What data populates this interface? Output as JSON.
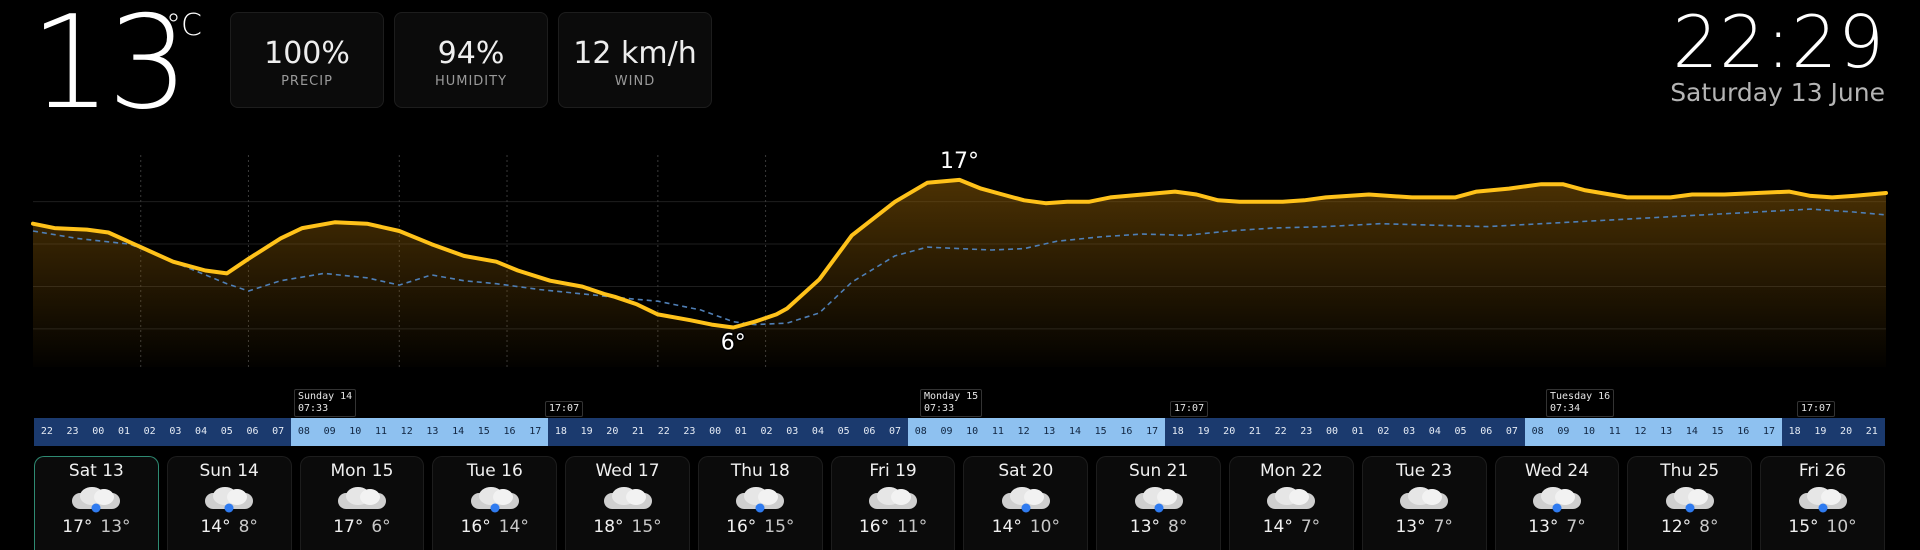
{
  "current": {
    "temperature": "13",
    "unit": "°C"
  },
  "stats": [
    {
      "value": "100%",
      "label": "PRECIP"
    },
    {
      "value": "94%",
      "label": "HUMIDITY"
    },
    {
      "value": "12 km/h",
      "label": "WIND"
    }
  ],
  "clock": {
    "time": "22:29",
    "date": "Saturday 13 June"
  },
  "chart": {
    "max_label": "17°",
    "min_label": "6°",
    "colors": {
      "temp": "#ffc21a",
      "feels": "#4f7fb6",
      "fill": "#8a5a06"
    }
  },
  "chart_data": {
    "type": "line",
    "x_unit": "hours from 22:00 Sat 13",
    "series": [
      {
        "name": "temperature",
        "x": [
          0,
          2,
          5,
          7,
          10,
          13,
          16,
          18,
          20,
          23,
          25,
          28,
          31,
          34,
          37,
          40,
          43,
          45,
          48,
          51,
          53,
          54,
          56,
          58,
          61,
          63,
          65,
          67,
          69,
          70,
          73,
          76,
          80,
          83,
          86,
          88,
          90,
          92,
          94,
          96,
          98,
          100,
          103,
          106,
          108,
          110,
          112,
          114,
          116,
          118,
          120,
          124,
          128,
          132,
          134,
          137,
          140,
          142,
          144,
          148,
          150,
          152,
          154,
          157,
          160,
          163,
          165,
          167,
          169,
          172
        ],
        "y": [
          13.8,
          13.5,
          13.4,
          13.2,
          12.2,
          11.2,
          10.6,
          10.4,
          11.4,
          12.8,
          13.5,
          13.9,
          13.8,
          13.3,
          12.4,
          11.6,
          11.2,
          10.6,
          9.9,
          9.5,
          9.0,
          8.8,
          8.3,
          7.6,
          7.2,
          6.9,
          6.7,
          7.1,
          7.6,
          8.0,
          10.0,
          13.0,
          15.3,
          16.6,
          16.8,
          16.2,
          15.8,
          15.4,
          15.2,
          15.3,
          15.3,
          15.6,
          15.8,
          16.0,
          15.8,
          15.4,
          15.3,
          15.3,
          15.3,
          15.4,
          15.6,
          15.8,
          15.6,
          15.6,
          16.0,
          16.2,
          16.5,
          16.5,
          16.1,
          15.6,
          15.6,
          15.6,
          15.8,
          15.8,
          15.9,
          16.0,
          15.7,
          15.6,
          15.7,
          15.9
        ]
      },
      {
        "name": "feels like",
        "x": [
          0,
          4,
          9,
          14,
          18,
          20,
          23,
          27,
          31,
          34,
          37,
          40,
          43,
          47,
          51,
          55,
          58,
          62,
          65,
          67,
          70,
          73,
          76,
          80,
          83,
          86,
          89,
          92,
          95,
          99,
          103,
          107,
          111,
          115,
          120,
          125,
          130,
          135,
          140,
          145,
          150,
          155,
          160,
          165,
          169,
          172
        ],
        "y": [
          13.3,
          12.8,
          12.4,
          10.9,
          9.7,
          9.2,
          9.9,
          10.4,
          10.1,
          9.6,
          10.3,
          9.9,
          9.7,
          9.3,
          9.0,
          8.7,
          8.5,
          7.9,
          7.1,
          6.9,
          7.0,
          7.7,
          9.8,
          11.6,
          12.2,
          12.1,
          12.0,
          12.1,
          12.6,
          12.9,
          13.1,
          13.0,
          13.3,
          13.5,
          13.6,
          13.8,
          13.7,
          13.6,
          13.8,
          14.0,
          14.2,
          14.4,
          14.6,
          14.8,
          14.6,
          14.4
        ]
      }
    ],
    "annotations": [
      {
        "text": "17°",
        "x": 86,
        "y": 16.8
      },
      {
        "text": "6°",
        "x": 65,
        "y": 6.7
      }
    ],
    "grid": true
  },
  "sun_times": [
    {
      "day": "Sunday 14",
      "sunrise": "07:33",
      "sunset": "17:07"
    },
    {
      "day": "Monday 15",
      "sunrise": "07:33",
      "sunset": "17:07"
    },
    {
      "day": "Tuesday 16",
      "sunrise": "07:34",
      "sunset": "17:07"
    }
  ],
  "hours": [
    "22",
    "23",
    "00",
    "01",
    "02",
    "03",
    "04",
    "05",
    "06",
    "07",
    "08",
    "09",
    "10",
    "11",
    "12",
    "13",
    "14",
    "15",
    "16",
    "17",
    "18",
    "19",
    "20",
    "21",
    "22",
    "23",
    "00",
    "01",
    "02",
    "03",
    "04",
    "05",
    "06",
    "07",
    "08",
    "09",
    "10",
    "11",
    "12",
    "13",
    "14",
    "15",
    "16",
    "17",
    "18",
    "19",
    "20",
    "21",
    "22",
    "23",
    "00",
    "01",
    "02",
    "03",
    "04",
    "05",
    "06",
    "07",
    "08",
    "09",
    "10",
    "11",
    "12",
    "13",
    "14",
    "15",
    "16",
    "17",
    "18",
    "19",
    "20",
    "21"
  ],
  "daylight_hours": [
    "08",
    "09",
    "10",
    "11",
    "12",
    "13",
    "14",
    "15",
    "16",
    "17"
  ],
  "forecast": [
    {
      "name": "Sat 13",
      "hi": "17°",
      "lo": "13°",
      "rain": true
    },
    {
      "name": "Sun 14",
      "hi": "14°",
      "lo": "8°",
      "rain": true
    },
    {
      "name": "Mon 15",
      "hi": "17°",
      "lo": "6°",
      "rain": false
    },
    {
      "name": "Tue 16",
      "hi": "16°",
      "lo": "14°",
      "rain": true
    },
    {
      "name": "Wed 17",
      "hi": "18°",
      "lo": "15°",
      "rain": false
    },
    {
      "name": "Thu 18",
      "hi": "16°",
      "lo": "15°",
      "rain": true
    },
    {
      "name": "Fri 19",
      "hi": "16°",
      "lo": "11°",
      "rain": false
    },
    {
      "name": "Sat 20",
      "hi": "14°",
      "lo": "10°",
      "rain": true
    },
    {
      "name": "Sun 21",
      "hi": "13°",
      "lo": "8°",
      "rain": true
    },
    {
      "name": "Mon 22",
      "hi": "14°",
      "lo": "7°",
      "rain": false
    },
    {
      "name": "Tue 23",
      "hi": "13°",
      "lo": "7°",
      "rain": false
    },
    {
      "name": "Wed 24",
      "hi": "13°",
      "lo": "7°",
      "rain": true
    },
    {
      "name": "Thu 25",
      "hi": "12°",
      "lo": "8°",
      "rain": true
    },
    {
      "name": "Fri 26",
      "hi": "15°",
      "lo": "10°",
      "rain": true
    }
  ]
}
